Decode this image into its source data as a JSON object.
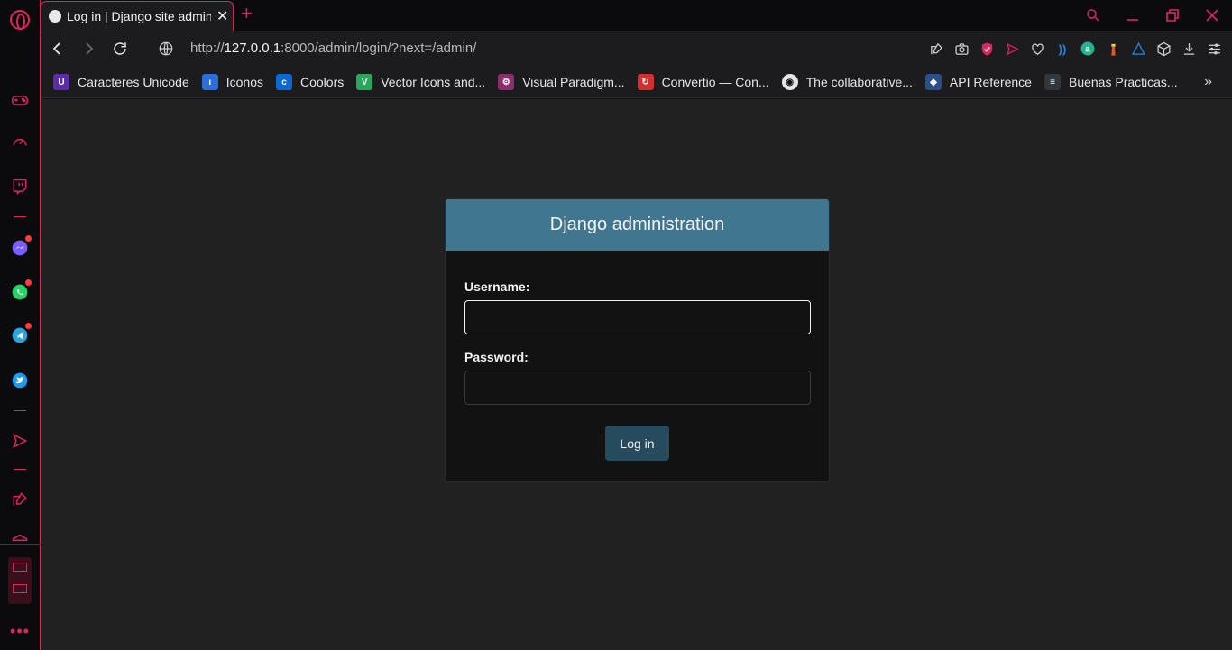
{
  "browser": {
    "tab": {
      "title": "Log in | Django site admin",
      "icon": "globe-icon"
    },
    "new_tab_label": "+",
    "address": {
      "prefix": "http://",
      "host": "127.0.0.1",
      "rest": ":8000/admin/login/?next=/admin/"
    },
    "accent_color": "#e0245e",
    "bookmarks": [
      {
        "label": "Caracteres Unicode",
        "icon": "unicode-table-icon",
        "color": "#5a2ea6",
        "glyph": "U"
      },
      {
        "label": "Iconos",
        "icon": "iconos-icon",
        "color": "#2a6fdb",
        "glyph": "ı"
      },
      {
        "label": "Coolors",
        "icon": "coolors-icon",
        "color": "#0e68d1",
        "glyph": "c"
      },
      {
        "label": "Vector Icons and...",
        "icon": "vector-icons-icon",
        "color": "#2aa65a",
        "glyph": "V"
      },
      {
        "label": "Visual Paradigm...",
        "icon": "visual-paradigm-icon",
        "color": "#8a2f6b",
        "glyph": "⚙"
      },
      {
        "label": "Convertio — Con...",
        "icon": "convertio-icon",
        "color": "#d32f2f",
        "glyph": "↻"
      },
      {
        "label": "The collaborative...",
        "icon": "collaborative-icon",
        "color": "#e6e6e6",
        "glyph": "◉"
      },
      {
        "label": "API Reference",
        "icon": "api-reference-icon",
        "color": "#2b4f8a",
        "glyph": "◆"
      },
      {
        "label": "Buenas Practicas...",
        "icon": "buenas-practicas-icon",
        "color": "#33373d",
        "glyph": "≡"
      }
    ]
  },
  "login": {
    "header": "Django administration",
    "username_label": "Username:",
    "username_value": "",
    "password_label": "Password:",
    "password_value": "",
    "submit_label": "Log in",
    "header_color": "#417690",
    "button_color": "#264b5d"
  }
}
